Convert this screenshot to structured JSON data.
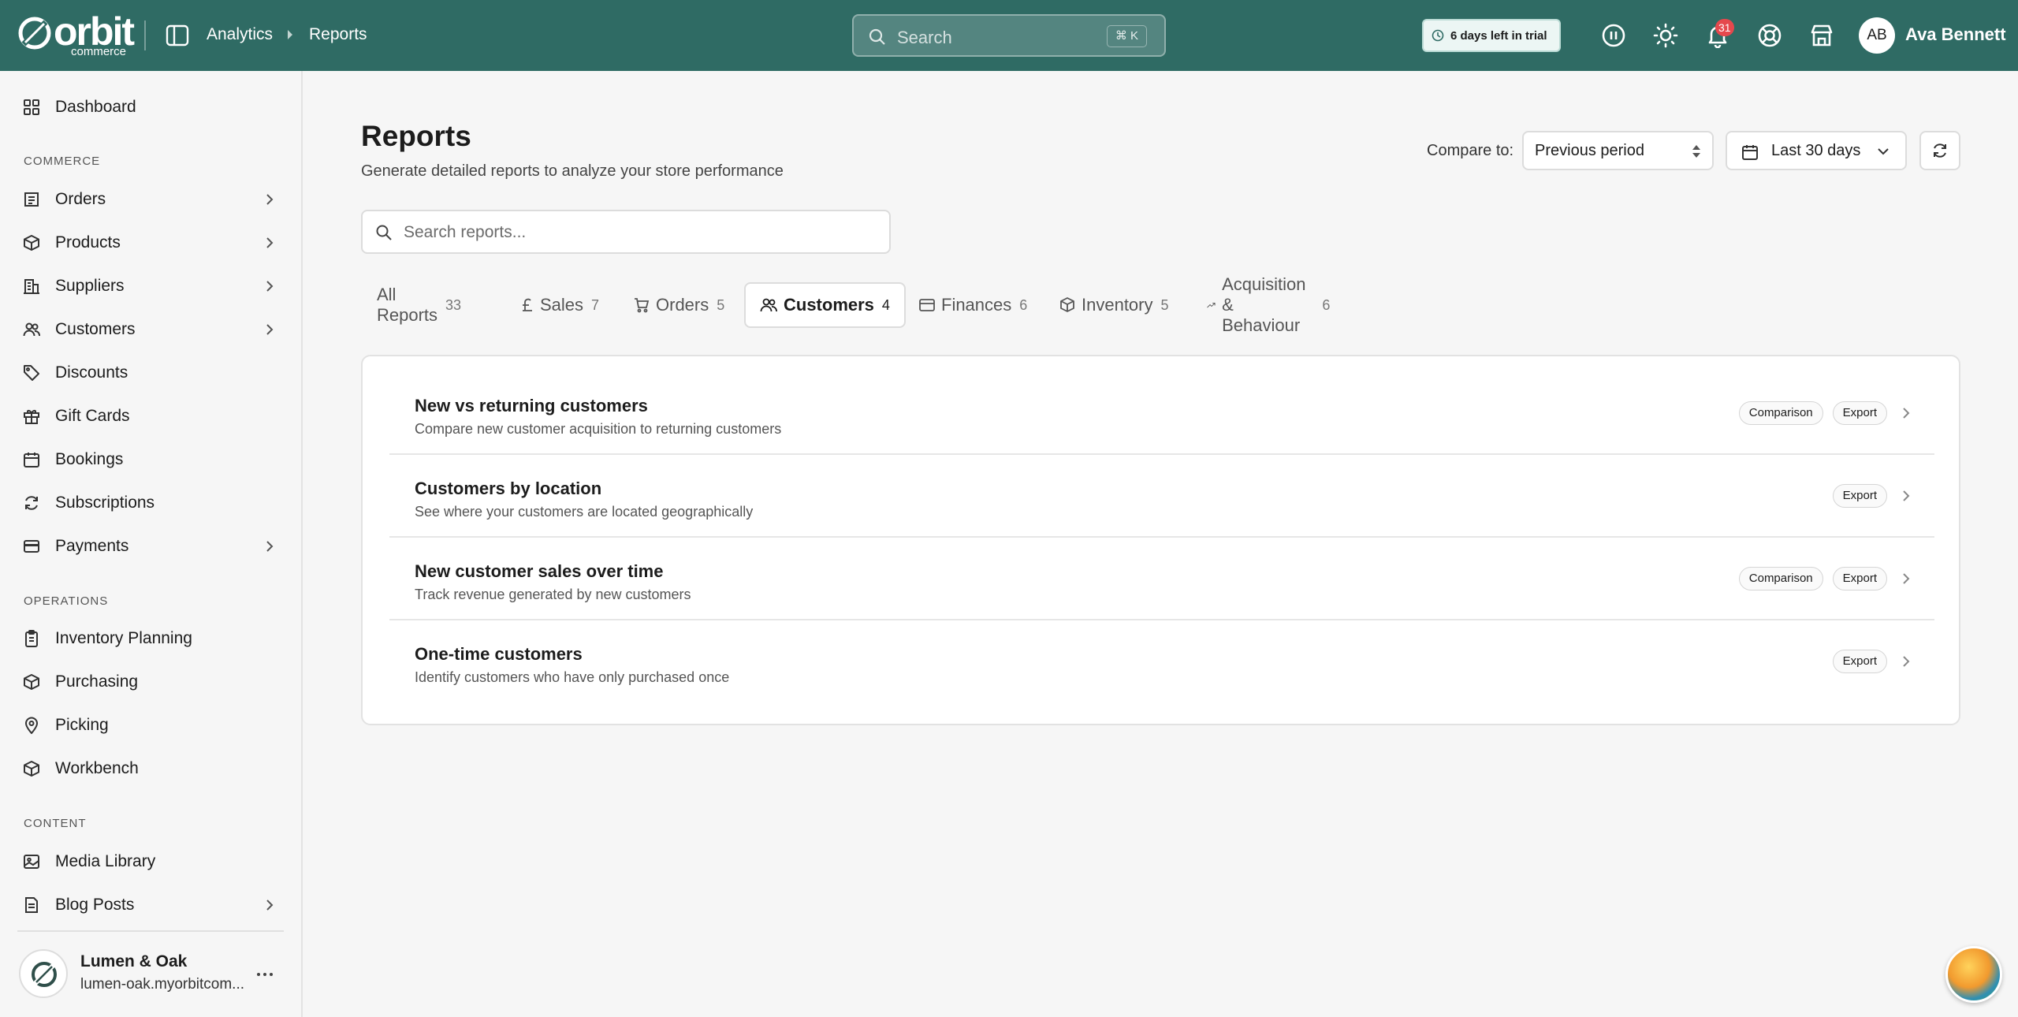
{
  "brand": {
    "word": "orbit",
    "sub": "commerce"
  },
  "breadcrumb": {
    "section": "Analytics",
    "page": "Reports"
  },
  "search": {
    "placeholder": "Search",
    "shortcut": "⌘ K"
  },
  "trial": {
    "label": "6 days left in trial"
  },
  "notifications": {
    "count": "31"
  },
  "user": {
    "initials": "AB",
    "name": "Ava Bennett"
  },
  "sidebar": {
    "dashboard": "Dashboard",
    "sections": {
      "commerce": "COMMERCE",
      "operations": "OPERATIONS",
      "content": "CONTENT"
    },
    "commerce": [
      {
        "label": "Orders",
        "icon": "orders-icon",
        "chevron": true
      },
      {
        "label": "Products",
        "icon": "package-icon",
        "chevron": true
      },
      {
        "label": "Suppliers",
        "icon": "building-icon",
        "chevron": true
      },
      {
        "label": "Customers",
        "icon": "users-icon",
        "chevron": true
      },
      {
        "label": "Discounts",
        "icon": "tag-icon",
        "chevron": false
      },
      {
        "label": "Gift Cards",
        "icon": "gift-icon",
        "chevron": false
      },
      {
        "label": "Bookings",
        "icon": "calendar-icon",
        "chevron": false
      },
      {
        "label": "Subscriptions",
        "icon": "refresh-icon",
        "chevron": false
      },
      {
        "label": "Payments",
        "icon": "card-icon",
        "chevron": true
      }
    ],
    "operations": [
      {
        "label": "Inventory Planning",
        "icon": "clipboard-icon"
      },
      {
        "label": "Purchasing",
        "icon": "cube-icon"
      },
      {
        "label": "Picking",
        "icon": "map-pin-icon"
      },
      {
        "label": "Workbench",
        "icon": "cube-icon"
      }
    ],
    "content": [
      {
        "label": "Media Library",
        "icon": "image-icon",
        "chevron": false
      },
      {
        "label": "Blog Posts",
        "icon": "document-icon",
        "chevron": true
      }
    ],
    "store": {
      "name": "Lumen & Oak",
      "url": "lumen-oak.myorbitcom..."
    }
  },
  "page": {
    "title": "Reports",
    "subtitle": "Generate detailed reports to analyze your store performance",
    "compare_label": "Compare to:",
    "compare_value": "Previous period",
    "date_range": "Last 30 days",
    "search_placeholder": "Search reports..."
  },
  "tabs": [
    {
      "label": "All Reports",
      "count": "33",
      "icon": ""
    },
    {
      "label": "Sales",
      "count": "7",
      "icon": "pound-icon"
    },
    {
      "label": "Orders",
      "count": "5",
      "icon": "cart-icon"
    },
    {
      "label": "Customers",
      "count": "4",
      "icon": "users-icon",
      "active": true
    },
    {
      "label": "Finances",
      "count": "6",
      "icon": "card-icon"
    },
    {
      "label": "Inventory",
      "count": "5",
      "icon": "cube-icon"
    },
    {
      "label": "Acquisition & Behaviour",
      "count": "6",
      "icon": "trend-icon"
    }
  ],
  "reports": [
    {
      "title": "New vs returning customers",
      "description": "Compare new customer acquisition to returning customers",
      "tags": [
        "Comparison",
        "Export"
      ]
    },
    {
      "title": "Customers by location",
      "description": "See where your customers are located geographically",
      "tags": [
        "Export"
      ]
    },
    {
      "title": "New customer sales over time",
      "description": "Track revenue generated by new customers",
      "tags": [
        "Comparison",
        "Export"
      ]
    },
    {
      "title": "One-time customers",
      "description": "Identify customers who have only purchased once",
      "tags": [
        "Export"
      ]
    }
  ],
  "colors": {
    "topbar": "#2f6b64",
    "accent": "#2f6b64",
    "badge": "#e5484d"
  }
}
